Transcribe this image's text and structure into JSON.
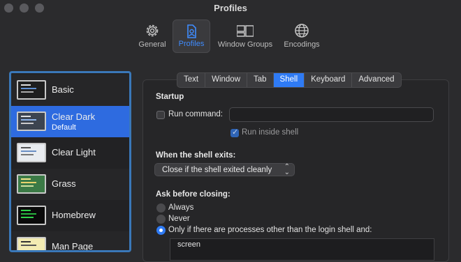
{
  "window": {
    "title": "Profiles"
  },
  "toolbar": {
    "items": [
      {
        "label": "General",
        "icon": "gear-icon"
      },
      {
        "label": "Profiles",
        "icon": "profile-document-icon"
      },
      {
        "label": "Window Groups",
        "icon": "window-groups-icon"
      },
      {
        "label": "Encodings",
        "icon": "globe-icon"
      }
    ],
    "active": "Profiles",
    "accent": "#3f8cff"
  },
  "profiles": [
    {
      "name": "Basic",
      "subtitle": "",
      "thumb_bg": "#1e1e1e"
    },
    {
      "name": "Clear Dark",
      "subtitle": "Default",
      "thumb_bg": "#3c4450"
    },
    {
      "name": "Clear Light",
      "subtitle": "",
      "thumb_bg": "#e9ecf0"
    },
    {
      "name": "Grass",
      "subtitle": "",
      "thumb_bg": "#3b7a46"
    },
    {
      "name": "Homebrew",
      "subtitle": "",
      "thumb_bg": "#0a0a0a"
    },
    {
      "name": "Man Page",
      "subtitle": "",
      "thumb_bg": "#f3ebb2"
    }
  ],
  "tabs": [
    "Text",
    "Window",
    "Tab",
    "Shell",
    "Keyboard",
    "Advanced"
  ],
  "active_tab": "Shell",
  "shell": {
    "startup_heading": "Startup",
    "run_command_label": "Run command:",
    "run_command_value": "",
    "run_command_checked": false,
    "run_inside_shell_label": "Run inside shell",
    "run_inside_shell_checked": true,
    "exit_heading": "When the shell exits:",
    "exit_option": "Close if the shell exited cleanly",
    "ask_heading": "Ask before closing:",
    "ask_options": [
      "Always",
      "Never",
      "Only if there are processes other than the login shell and:"
    ],
    "ask_selected": 2,
    "process_list": [
      "screen"
    ]
  }
}
